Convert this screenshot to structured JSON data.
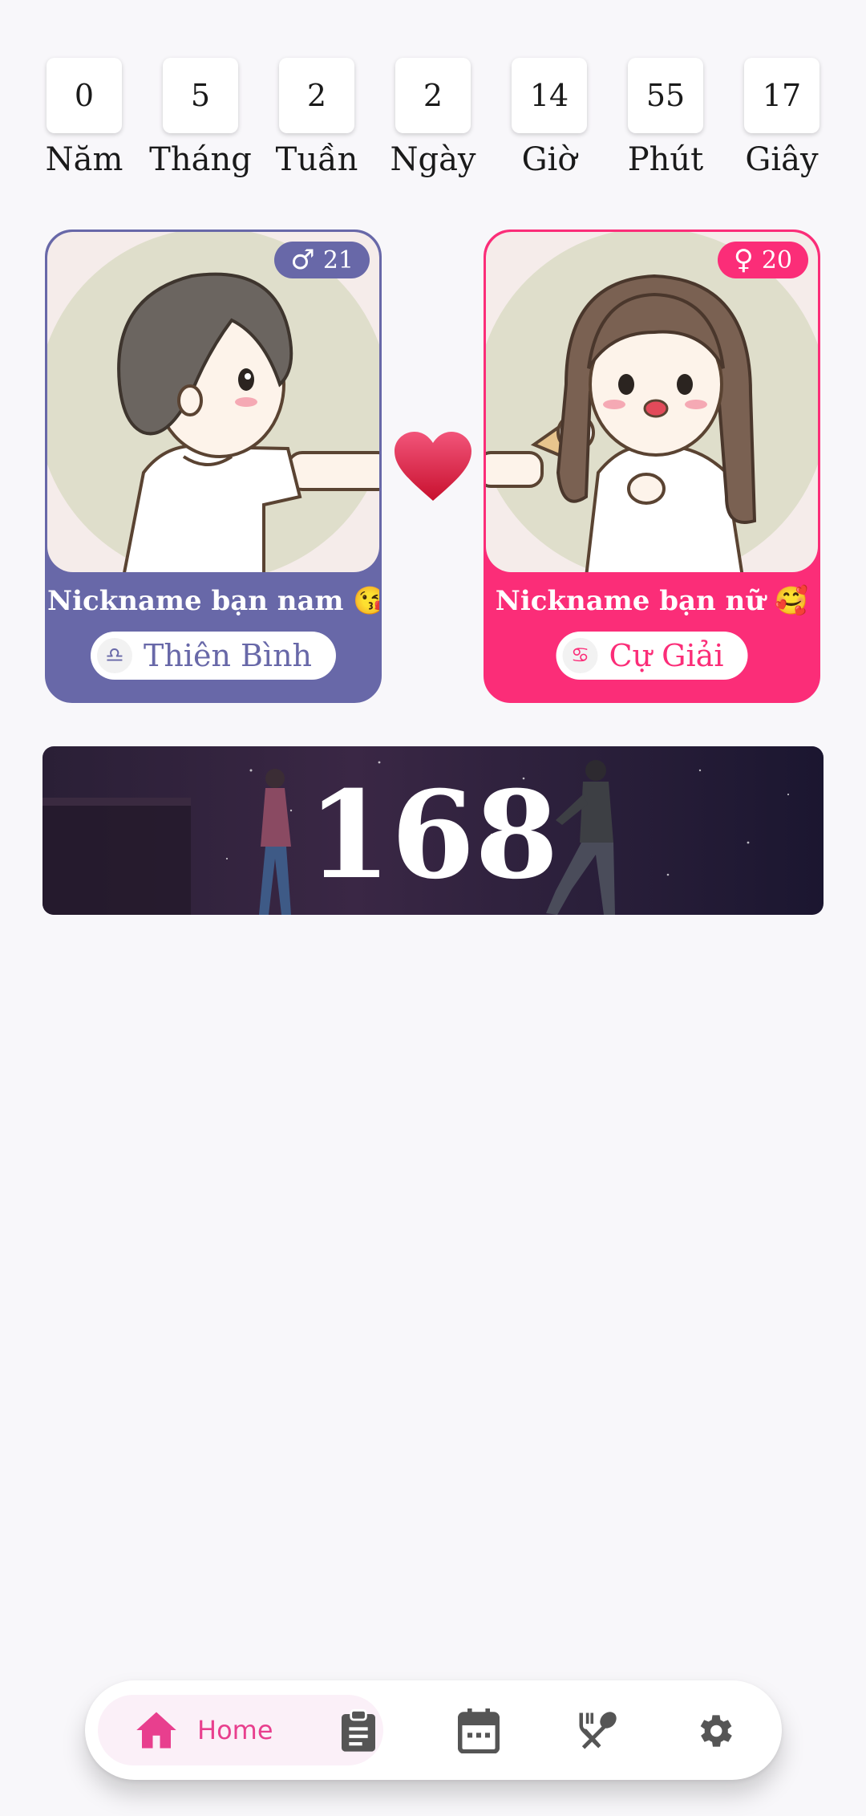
{
  "counters": [
    {
      "value": "0",
      "label": "Năm"
    },
    {
      "value": "5",
      "label": "Tháng"
    },
    {
      "value": "2",
      "label": "Tuần"
    },
    {
      "value": "2",
      "label": "Ngày"
    },
    {
      "value": "14",
      "label": "Giờ"
    },
    {
      "value": "55",
      "label": "Phút"
    },
    {
      "value": "17",
      "label": "Giây"
    }
  ],
  "male": {
    "age": "21",
    "gender_icon": "male-symbol-icon",
    "nickname": "Nickname bạn nam 😘",
    "zodiac": "Thiên Bình",
    "zodiac_icon": "libra-icon",
    "accent": "#6868a8"
  },
  "female": {
    "age": "20",
    "gender_icon": "female-symbol-icon",
    "nickname": "Nickname bạn nữ 🥰",
    "zodiac": "Cự Giải",
    "zodiac_icon": "cancer-icon",
    "accent": "#fb2d78"
  },
  "heart_icon": "heart-icon",
  "banner": {
    "days": "168"
  },
  "nav": {
    "items": [
      {
        "icon": "home-icon",
        "label": "Home",
        "active": true
      },
      {
        "icon": "clipboard-icon"
      },
      {
        "icon": "calendar-icon"
      },
      {
        "icon": "fork-spoon-icon"
      },
      {
        "icon": "gear-icon"
      }
    ],
    "active_color": "#e83f8e",
    "inactive_color": "#555555"
  }
}
